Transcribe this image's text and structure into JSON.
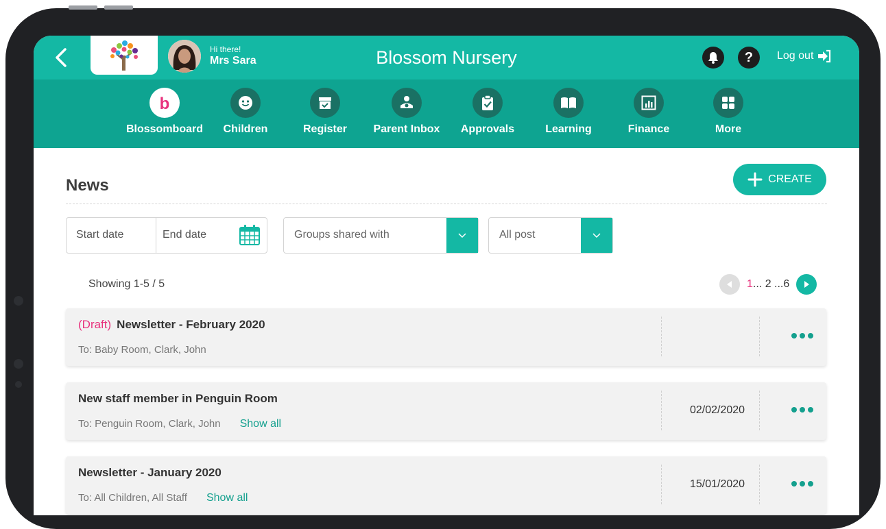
{
  "header": {
    "title": "Blossom Nursery",
    "greeting": "Hi there!",
    "user_name": "Mrs Sara",
    "help_label": "?",
    "logout_label": "Log out"
  },
  "nav": {
    "items": [
      {
        "label": "Blossomboard",
        "icon": "blossomboard-icon"
      },
      {
        "label": "Children",
        "icon": "smiley-icon"
      },
      {
        "label": "Register",
        "icon": "register-icon"
      },
      {
        "label": "Parent Inbox",
        "icon": "parent-inbox-icon"
      },
      {
        "label": "Approvals",
        "icon": "clipboard-check-icon"
      },
      {
        "label": "Learning",
        "icon": "book-icon"
      },
      {
        "label": "Finance",
        "icon": "chart-icon"
      },
      {
        "label": "More",
        "icon": "grid-icon"
      }
    ]
  },
  "page": {
    "title": "News",
    "create_label": "CREATE"
  },
  "filters": {
    "start_date_placeholder": "Start date",
    "end_date_placeholder": "End date",
    "groups_placeholder": "Groups shared with",
    "post_type": "All post"
  },
  "listing": {
    "showing": "Showing 1-5 / 5",
    "current_page": "1",
    "page_rest": "... 2 ...6"
  },
  "posts": [
    {
      "draft_label": "(Draft)",
      "title": "Newsletter - February 2020",
      "to": "To: Baby Room, Clark, John",
      "date": "",
      "show_all": ""
    },
    {
      "draft_label": "",
      "title": "New staff member in Penguin Room",
      "to": "To: Penguin Room, Clark, John",
      "date": "02/02/2020",
      "show_all": "Show all"
    },
    {
      "draft_label": "",
      "title": "Newsletter - January 2020",
      "to": "To: All Children, All Staff",
      "date": "15/01/2020",
      "show_all": "Show all"
    }
  ],
  "colors": {
    "primary": "#14b8a4",
    "nav_background": "#0ea491",
    "accent_pink": "#e8327d"
  }
}
